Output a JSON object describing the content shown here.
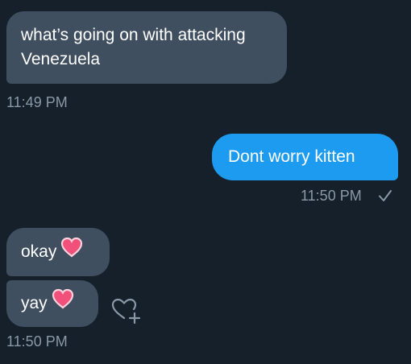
{
  "messages": [
    {
      "text": "what’s going on with attacking Venezuela",
      "direction": "incoming",
      "timestamp": "11:49 PM"
    },
    {
      "text": "Dont worry kitten",
      "direction": "outgoing",
      "timestamp": "11:50 PM",
      "status_icon": "sent-check-icon"
    },
    {
      "text": "okay",
      "direction": "incoming",
      "emoji": "pink-heart-emoji"
    },
    {
      "text": "yay",
      "direction": "incoming",
      "emoji": "pink-heart-emoji",
      "timestamp": "11:50 PM"
    }
  ],
  "reaction_button_icon": "add-reaction-heart-icon",
  "colors": {
    "background": "#15202b",
    "incoming_bubble": "#3f4f5f",
    "outgoing_bubble": "#1d9bf0",
    "timestamp": "#8b98a5",
    "heart": "#f0507a"
  }
}
